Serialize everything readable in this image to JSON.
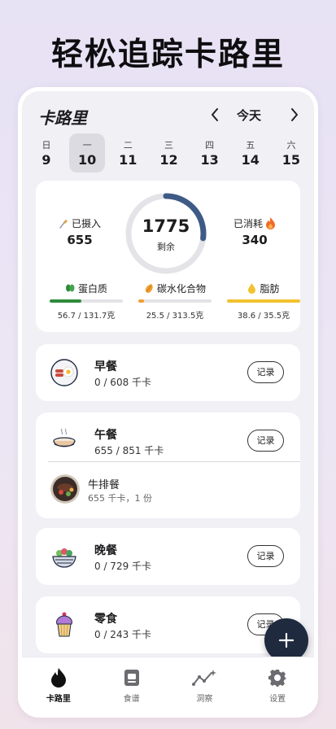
{
  "headline": "轻松追踪卡路里",
  "app": {
    "title": "卡路里",
    "date_label": "今天"
  },
  "week": [
    {
      "weekday": "日",
      "date": "9"
    },
    {
      "weekday": "一",
      "date": "10",
      "selected": true
    },
    {
      "weekday": "二",
      "date": "11"
    },
    {
      "weekday": "三",
      "date": "12"
    },
    {
      "weekday": "四",
      "date": "13"
    },
    {
      "weekday": "五",
      "date": "14"
    },
    {
      "weekday": "六",
      "date": "15"
    }
  ],
  "summary": {
    "intake_label": "已摄入",
    "intake_value": "655",
    "remaining_value": "1775",
    "remaining_label": "剩余",
    "burned_label": "已消耗",
    "burned_value": "340",
    "ring_progress": 0.27,
    "ring_color": "#3e5a86"
  },
  "macros": [
    {
      "name": "蛋白质",
      "value": "56.7 / 131.7克",
      "progress": 0.43,
      "color": "#2e8b3a",
      "icon": "bean-icon"
    },
    {
      "name": "碳水化合物",
      "value": "25.5 / 313.5克",
      "progress": 0.08,
      "color": "#f0a030",
      "icon": "grain-icon"
    },
    {
      "name": "脂肪",
      "value": "38.6 / 35.5克",
      "progress": 1.0,
      "color": "#f2c230",
      "icon": "oil-drop-icon"
    }
  ],
  "meals": {
    "breakfast": {
      "name": "早餐",
      "calories": "0 / 608 千卡",
      "button": "记录"
    },
    "lunch": {
      "name": "午餐",
      "calories": "655 / 851 千卡",
      "button": "记录",
      "items": [
        {
          "name": "牛排餐",
          "detail": "655 千卡，1 份"
        }
      ]
    },
    "dinner": {
      "name": "晚餐",
      "calories": "0 / 729 千卡",
      "button": "记录"
    },
    "snack": {
      "name": "零食",
      "calories": "0 / 243 千卡",
      "button": "记录"
    }
  },
  "fab_icon": "plus-icon",
  "tabs": [
    {
      "label": "卡路里",
      "icon": "flame-icon",
      "active": true
    },
    {
      "label": "食谱",
      "icon": "recipe-icon"
    },
    {
      "label": "洞察",
      "icon": "insights-icon"
    },
    {
      "label": "设置",
      "icon": "gear-icon"
    }
  ]
}
